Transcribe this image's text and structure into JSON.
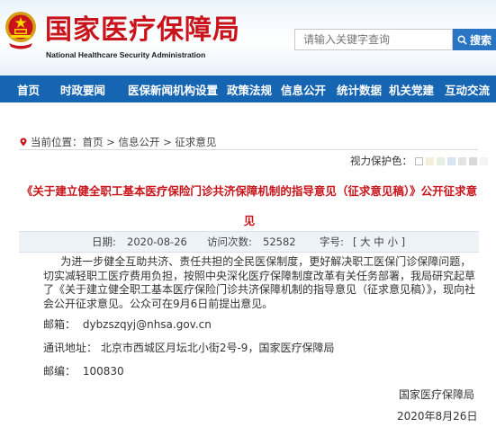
{
  "header": {
    "site_title": "国家医疗保障局",
    "site_subtitle": "National Healthcare Security Administration",
    "search_placeholder": "请输入关键字查询",
    "search_button": "搜索"
  },
  "nav": {
    "items": [
      "首页",
      "时政要闻",
      "医保新闻",
      "机构设置",
      "政策法规",
      "信息公开",
      "统计数据",
      "机关党建",
      "互动交流"
    ]
  },
  "breadcrumb": {
    "prefix": "当前位置：",
    "path": "首页 > 信息公开 > 征求意见"
  },
  "vision": {
    "label": "视力保护色：",
    "colors": [
      "#ffffff",
      "#f6eed6",
      "#e6f0e0",
      "#d8e3f3",
      "#e3e3e3",
      "#d8d8d8",
      "#f3f3f3"
    ]
  },
  "article": {
    "title": "《关于建立健全职工基本医疗保险门诊共济保障机制的指导意见（征求意见稿）》公开征求意见",
    "date_label": "日期:",
    "date": "2020-08-26",
    "views_label": "访问次数:",
    "views": "52582",
    "size_label": "字号:",
    "size_options": "[ 大 中 小 ]",
    "body": "为进一步健全互助共济、责任共担的全民医保制度，更好解决职工医保门诊保障问题，切实减轻职工医疗费用负担，按照中央深化医疗保障制度改革有关任务部署，我局研究起草了《关于建立健全职工基本医疗保险门诊共济保障机制的指导意见（征求意见稿）》，现向社会公开征求意见。公众可在9月6日前提出意见。",
    "email_label": "邮箱：",
    "email": "dybzszqyj@nhsa.gov.cn",
    "address_label": "通讯地址：",
    "address": "北京市西城区月坛北小街2号-9，国家医疗保障局",
    "postcode_label": "邮编：",
    "postcode": "100830",
    "signature": "国家医疗保障局",
    "sign_date": "2020年8月26日"
  }
}
